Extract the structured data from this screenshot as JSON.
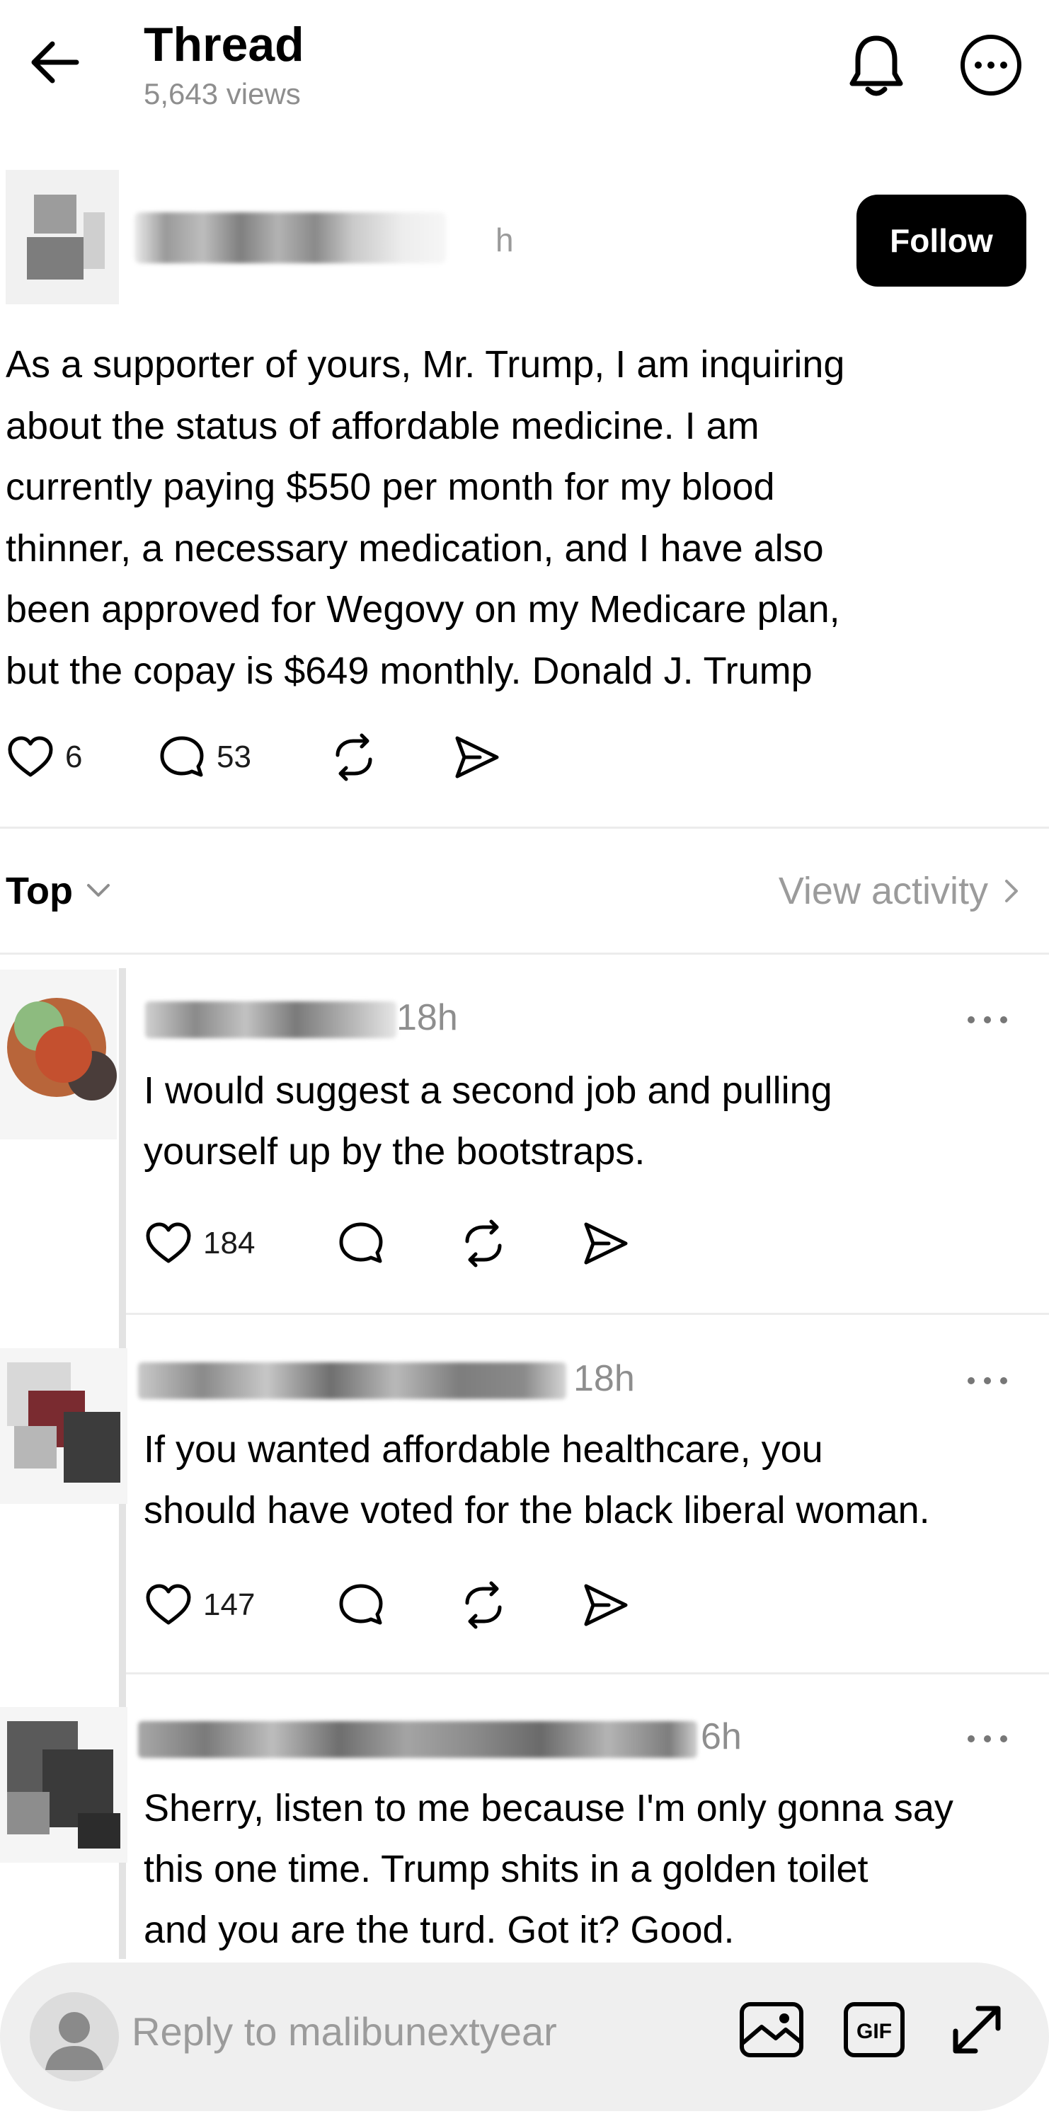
{
  "header": {
    "title": "Thread",
    "views": "5,643 views"
  },
  "post": {
    "time": "h",
    "follow_label": "Follow",
    "text_lines": [
      "As a supporter of yours, Mr. Trump, I am inquiring",
      "about the status of affordable medicine. I am",
      "currently paying $550 per month for my blood",
      "thinner, a necessary medication, and I have also",
      "been approved for Wegovy on my Medicare plan,",
      "but the copay is $649 monthly. Donald J. Trump"
    ],
    "likes": "6",
    "comments": "53"
  },
  "filter": {
    "sort_label": "Top",
    "activity_label": "View activity"
  },
  "replies": [
    {
      "time": "18h",
      "text_lines": [
        "I would suggest a second job and pulling",
        "yourself up by the bootstraps."
      ],
      "likes": "184"
    },
    {
      "time": "18h",
      "text_lines": [
        "If you wanted affordable healthcare, you",
        "should have voted for the black liberal woman."
      ],
      "likes": "147"
    },
    {
      "time": "6h",
      "text_lines": [
        "Sherry, listen to me because I'm only gonna say",
        "this one time. Trump shits in a golden toilet",
        "and you are the turd. Got it? Good."
      ]
    }
  ],
  "composer": {
    "placeholder": "Reply to malibunextyear"
  },
  "icons": {
    "back": "arrow-left-icon",
    "notifications": "bell-icon",
    "more": "ellipsis-circle-icon",
    "like": "heart-icon",
    "comment": "speech-bubble-icon",
    "repost": "repost-icon",
    "share": "send-icon",
    "image": "image-icon",
    "gif": "gif-icon",
    "expand": "expand-icon"
  }
}
